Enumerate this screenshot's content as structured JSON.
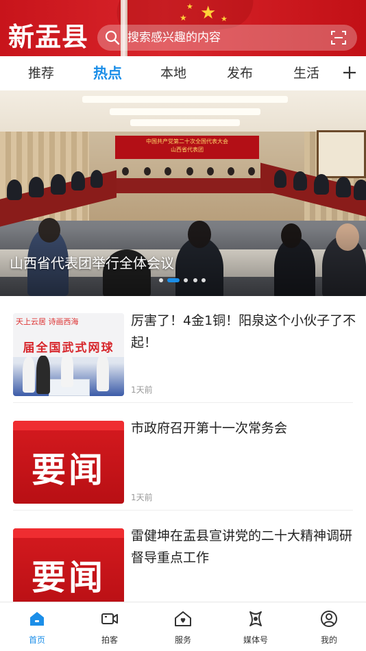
{
  "header": {
    "app_title": "新盂县",
    "search_placeholder": "搜索感兴趣的内容"
  },
  "tabs": [
    {
      "label": "推荐"
    },
    {
      "label": "热点"
    },
    {
      "label": "本地"
    },
    {
      "label": "发布"
    },
    {
      "label": "生活"
    }
  ],
  "banner": {
    "caption": "山西省代表团举行全体会议",
    "screen_line1": "中国共产党第二十次全国代表大会",
    "screen_line2": "山西省代表团",
    "slide_count": 5,
    "active_slide": 2
  },
  "news": [
    {
      "title": "厉害了！4金1铜！阳泉这个小伙子了不起！",
      "time": "1天前",
      "thumb_top_text": "天上云居  诗画西海",
      "thumb_red_text": "届全国武式网球"
    },
    {
      "title": "市政府召开第十一次常务会",
      "time": "1天前",
      "thumb_text": "要闻"
    },
    {
      "title": "雷健坤在盂县宣讲党的二十大精神调研督导重点工作",
      "thumb_text": "要闻"
    }
  ],
  "bottom_nav": [
    {
      "label": "首页",
      "icon": "home-icon",
      "active": true
    },
    {
      "label": "拍客",
      "icon": "video-camera-icon"
    },
    {
      "label": "服务",
      "icon": "service-house-icon"
    },
    {
      "label": "媒体号",
      "icon": "media-icon"
    },
    {
      "label": "我的",
      "icon": "user-icon"
    }
  ],
  "colors": {
    "accent": "#1b8ee8",
    "header_red": "#c8141b"
  }
}
